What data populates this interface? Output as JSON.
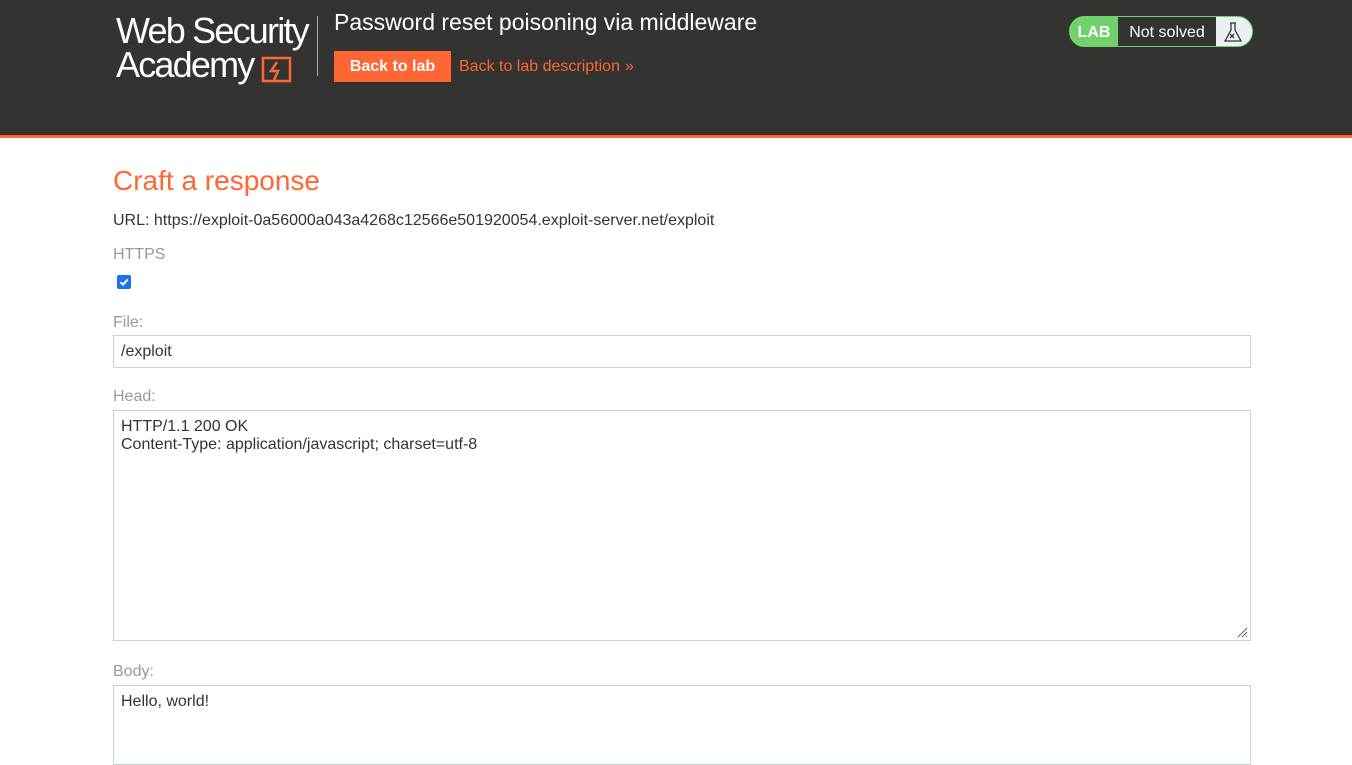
{
  "header": {
    "logo_line1": "Web Security",
    "logo_line2": "Academy",
    "lab_title": "Password reset poisoning via middleware",
    "back_to_lab": "Back to lab",
    "back_to_description": "Back to lab description",
    "status_badge": "LAB",
    "status_text": "Not solved"
  },
  "main": {
    "heading": "Craft a response",
    "url_line": "URL: https://exploit-0a56000a043a4268c12566e501920054.exploit-server.net/exploit",
    "https_label": "HTTPS",
    "https_checked": true,
    "file_label": "File:",
    "file_value": "/exploit",
    "head_label": "Head:",
    "head_value": "HTTP/1.1 200 OK\nContent-Type: application/javascript; charset=utf-8",
    "body_label": "Body:",
    "body_value": "Hello, world!"
  },
  "colors": {
    "accent": "#ff6633",
    "header_bg": "#333332",
    "status_green": "#70d16d",
    "checkbox_blue": "#1a73e8"
  },
  "icons": [
    "web-security-academy-logo",
    "chevron-double-right-icon",
    "flask-icon",
    "checkbox-check-icon",
    "resize-handle-icon"
  ]
}
